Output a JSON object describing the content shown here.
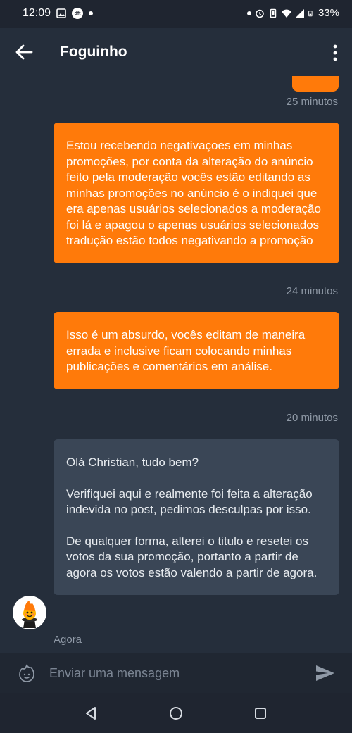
{
  "status_bar": {
    "time": "12:09",
    "carrier_badge": "dft",
    "battery": "33%"
  },
  "app_bar": {
    "title": "Foguinho"
  },
  "messages": [
    {
      "time": "25 minutos"
    },
    {
      "text": "Estou recebendo negativaçoes em minhas promoções, por conta da alteração do anúncio feito pela moderação vocês estão editando as minhas promoções no anúncio é o indiquei que era apenas usuários selecionados a moderação foi lá e apagou o apenas usuários selecionados tradução estão todos negativando a promoção",
      "time": "24 minutos"
    },
    {
      "text": "Isso é um absurdo, vocês editam de maneira errada e inclusive ficam colocando minhas publicações e comentários em análise.",
      "time": "20 minutos"
    },
    {
      "paragraphs": [
        "Olá Christian, tudo bem?",
        "Verifiquei aqui e realmente foi feita a alteração indevida no post, pedimos desculpas por isso.",
        "De qualquer forma, alterei o titulo e resetei os votos da sua promoção, portanto a partir de agora os votos estão valendo a partir de agora."
      ],
      "time": "Agora"
    }
  ],
  "composer": {
    "placeholder": "Enviar uma mensagem"
  },
  "colors": {
    "outgoing": "#ff7a0a",
    "incoming": "#3a4656",
    "background": "#252e3b"
  }
}
